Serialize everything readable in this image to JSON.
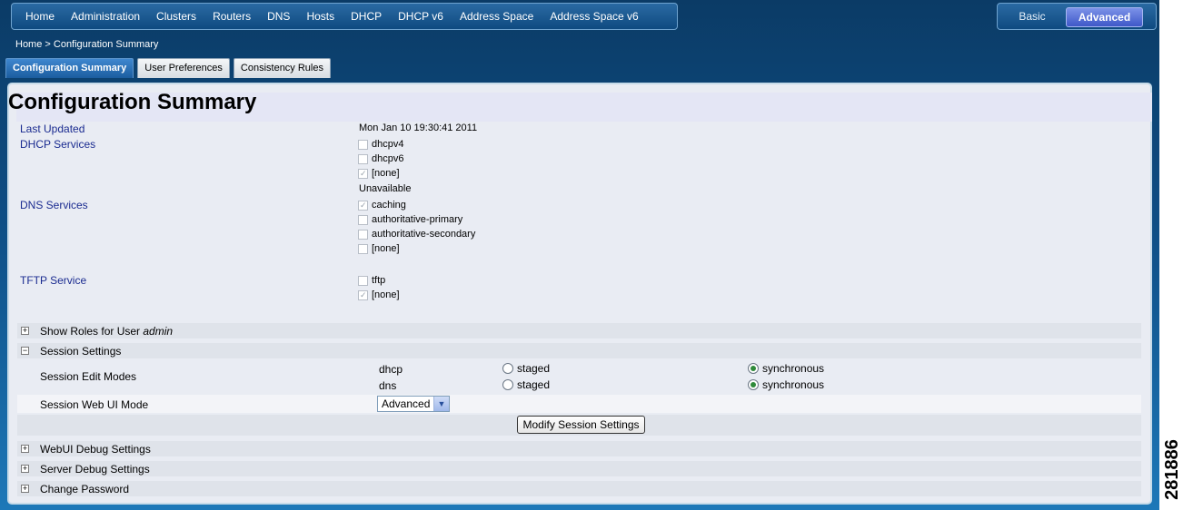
{
  "nav": {
    "items": [
      "Home",
      "Administration",
      "Clusters",
      "Routers",
      "DNS",
      "Hosts",
      "DHCP",
      "DHCP v6",
      "Address Space",
      "Address Space v6"
    ]
  },
  "mode_switch": {
    "basic": "Basic",
    "advanced": "Advanced",
    "selected": "Advanced"
  },
  "breadcrumb": "Home > Configuration Summary",
  "tabs": [
    {
      "label": "Configuration Summary",
      "active": true
    },
    {
      "label": "User Preferences",
      "active": false
    },
    {
      "label": "Consistency Rules",
      "active": false
    }
  ],
  "page_title": "Configuration Summary",
  "summary": {
    "last_updated_label": "Last Updated",
    "last_updated_value": "Mon Jan 10 19:30:41 2011",
    "dhcp_label": "DHCP Services",
    "dhcp_options": [
      {
        "label": "dhcpv4",
        "checked": false
      },
      {
        "label": "dhcpv6",
        "checked": false
      },
      {
        "label": "[none]",
        "checked": true
      }
    ],
    "dhcp_status": "Unavailable",
    "dns_label": "DNS Services",
    "dns_options": [
      {
        "label": "caching",
        "checked": true
      },
      {
        "label": "authoritative-primary",
        "checked": false
      },
      {
        "label": "authoritative-secondary",
        "checked": false
      },
      {
        "label": "[none]",
        "checked": false
      }
    ],
    "tftp_label": "TFTP Service",
    "tftp_options": [
      {
        "label": "tftp",
        "checked": false
      },
      {
        "label": "[none]",
        "checked": true
      }
    ]
  },
  "sections": {
    "show_roles": {
      "prefix": "Show Roles for User ",
      "user": "admin",
      "expanded": false
    },
    "session_settings": {
      "title": "Session Settings",
      "expanded": true
    },
    "webui_debug": {
      "title": "WebUI Debug Settings",
      "expanded": false
    },
    "server_debug": {
      "title": "Server Debug Settings",
      "expanded": false
    },
    "change_password": {
      "title": "Change Password",
      "expanded": false
    }
  },
  "session": {
    "edit_modes_label": "Session Edit Modes",
    "modes": [
      {
        "name": "dhcp",
        "staged_label": "staged",
        "sync_label": "synchronous",
        "value": "synchronous"
      },
      {
        "name": "dns",
        "staged_label": "staged",
        "sync_label": "synchronous",
        "value": "synchronous"
      }
    ],
    "web_ui_mode_label": "Session Web UI Mode",
    "web_ui_mode_value": "Advanced",
    "modify_button": "Modify Session Settings"
  },
  "figure_number": "281886"
}
